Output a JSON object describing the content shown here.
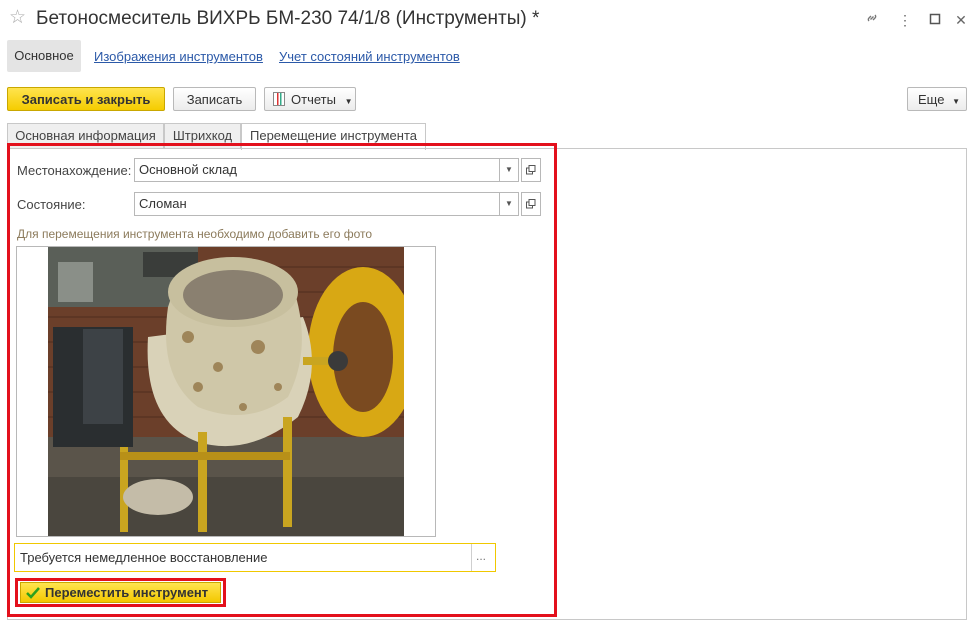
{
  "window": {
    "title": "Бетоносмеситель ВИХРЬ БМ-230 74/1/8 (Инструменты) *",
    "link_icon": "link-icon",
    "more_icon": "vertical-dots-icon",
    "maximize_icon": "maximize-icon",
    "close_icon": "close-icon"
  },
  "nav": {
    "active": "Основное",
    "links": [
      "Изображения инструментов",
      "Учет состояний инструментов"
    ]
  },
  "toolbar": {
    "save_close": "Записать и закрыть",
    "save": "Записать",
    "reports": "Отчеты",
    "more": "Еще"
  },
  "tabs": [
    "Основная информация",
    "Штрихкод",
    "Перемещение инструмента"
  ],
  "form": {
    "location_label": "Местонахождение:",
    "location_value": "Основной склад",
    "state_label": "Состояние:",
    "state_value": "Сломан",
    "photo_hint": "Для перемещения инструмента необходимо добавить его фото",
    "comment_value": "Требуется немедленное восстановление",
    "comment_btn": "...",
    "move_button": "Переместить инструмент"
  },
  "colors": {
    "accent_yellow": "#f5cc00",
    "highlight_red": "#e3101c",
    "link_blue": "#2b59a8"
  }
}
